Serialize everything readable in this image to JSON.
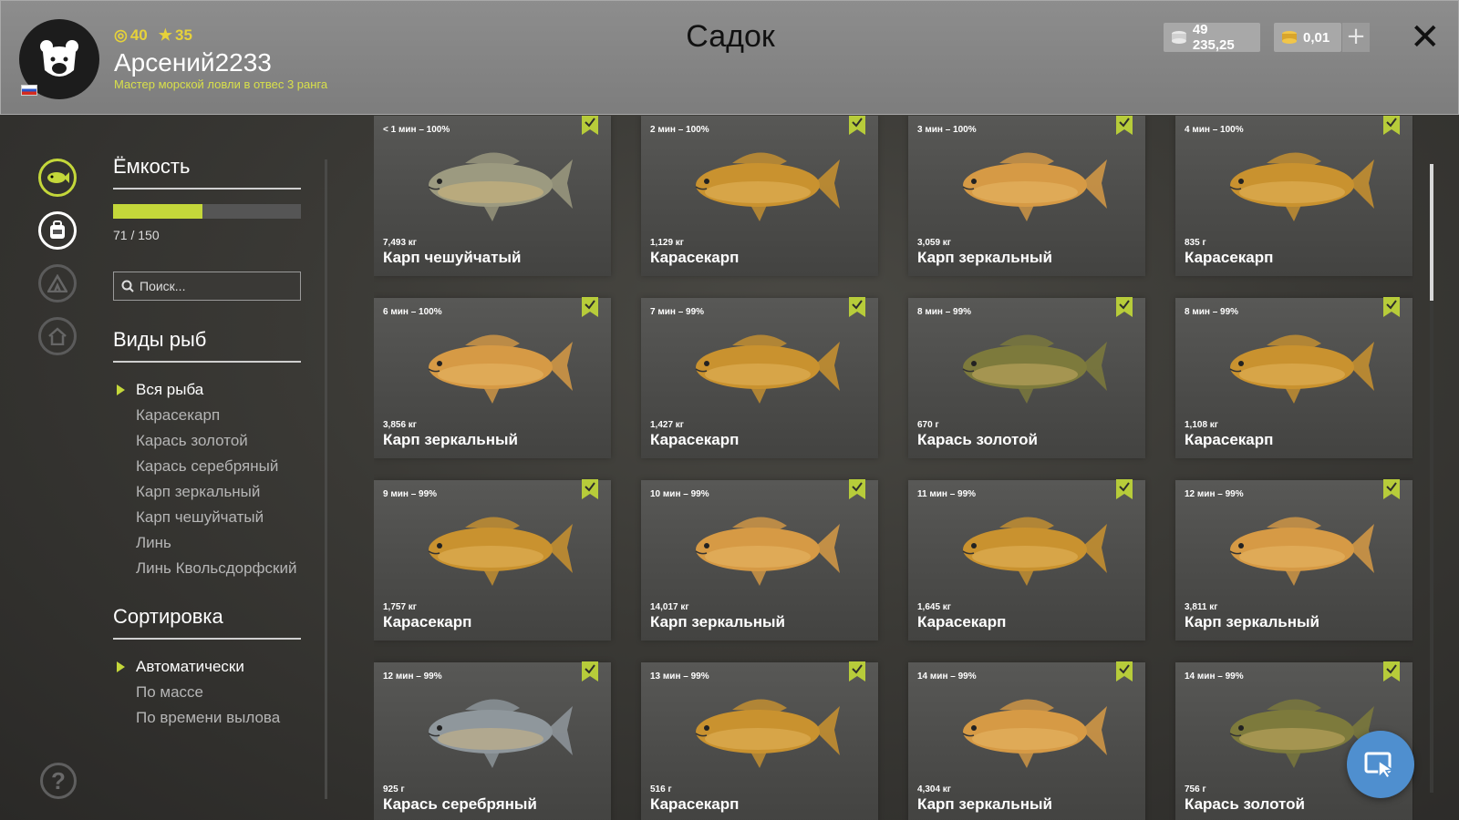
{
  "header": {
    "title": "Садок",
    "user": {
      "name": "Арсений2233",
      "rank": "Мастер морской ловли в отвес 3 ранга",
      "level": "40",
      "stars": "35"
    },
    "currency": {
      "silver": "49 235,25",
      "gold": "0,01"
    },
    "add_label": "+",
    "close_label": "✕"
  },
  "sidebar": {
    "capacity_title": "Ёмкость",
    "capacity": {
      "current": 71,
      "max": 150,
      "label": "71 / 150"
    },
    "search_placeholder": "Поиск...",
    "species_title": "Виды рыб",
    "species": [
      "Вся рыба",
      "Карасекарп",
      "Карась золотой",
      "Карась серебряный",
      "Карп зеркальный",
      "Карп чешуйчатый",
      "Линь",
      "Линь Квольсдорфский"
    ],
    "species_selected": "Вся рыба",
    "sort_title": "Сортировка",
    "sort": [
      "Автоматически",
      "По массе",
      "По времени вылова"
    ],
    "sort_selected": "Автоматически",
    "help_label": "?"
  },
  "fish": [
    {
      "time": "< 1 мин – 100%",
      "weight": "7,493 кг",
      "name": "Карп чешуйчатый",
      "color": "#9c9a80"
    },
    {
      "time": "2 мин – 100%",
      "weight": "1,129 кг",
      "name": "Карасекарп",
      "color": "#c9922f"
    },
    {
      "time": "3 мин – 100%",
      "weight": "3,059 кг",
      "name": "Карп зеркальный",
      "color": "#d69a45"
    },
    {
      "time": "4 мин – 100%",
      "weight": "835 г",
      "name": "Карасекарп",
      "color": "#c9922f"
    },
    {
      "time": "6 мин – 100%",
      "weight": "3,856 кг",
      "name": "Карп зеркальный",
      "color": "#d69a45"
    },
    {
      "time": "7 мин – 99%",
      "weight": "1,427 кг",
      "name": "Карасекарп",
      "color": "#c9922f"
    },
    {
      "time": "8 мин – 99%",
      "weight": "670 г",
      "name": "Карась золотой",
      "color": "#7d7a3c"
    },
    {
      "time": "8 мин – 99%",
      "weight": "1,108 кг",
      "name": "Карасекарп",
      "color": "#c9922f"
    },
    {
      "time": "9 мин – 99%",
      "weight": "1,757 кг",
      "name": "Карасекарп",
      "color": "#c9922f"
    },
    {
      "time": "10 мин – 99%",
      "weight": "14,017 кг",
      "name": "Карп зеркальный",
      "color": "#d69a45"
    },
    {
      "time": "11 мин – 99%",
      "weight": "1,645 кг",
      "name": "Карасекарп",
      "color": "#c9922f"
    },
    {
      "time": "12 мин – 99%",
      "weight": "3,811 кг",
      "name": "Карп зеркальный",
      "color": "#d69a45"
    },
    {
      "time": "12 мин – 99%",
      "weight": "925 г",
      "name": "Карась серебряный",
      "color": "#8f979c"
    },
    {
      "time": "13 мин – 99%",
      "weight": "516 г",
      "name": "Карасекарп",
      "color": "#c9922f"
    },
    {
      "time": "14 мин – 99%",
      "weight": "4,304 кг",
      "name": "Карп зеркальный",
      "color": "#d69a45"
    },
    {
      "time": "14 мин – 99%",
      "weight": "756 г",
      "name": "Карась золотой",
      "color": "#7d7a3c"
    }
  ],
  "colors": {
    "accent": "#c4d73a",
    "fab": "#4f8fcf"
  },
  "icons": [
    "bear-logo-icon",
    "fish-icon",
    "bag-icon",
    "tent-icon",
    "home-icon",
    "help-icon",
    "search-icon",
    "coin-icon",
    "gold-icon",
    "bookmark-icon",
    "cursor-icon"
  ]
}
